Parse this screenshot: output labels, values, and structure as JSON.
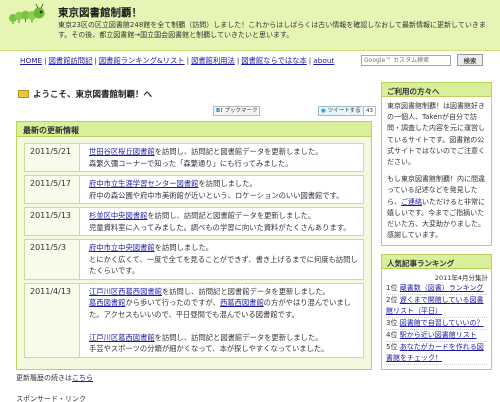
{
  "header": {
    "title": "東京図書館制覇！",
    "description": "東京23区の区立図書館248館を全て制覇（訪問）しました！これからはしばらくは古い情報を確認しなおして最新情報に更新していきます。その後、都立図書館→国立国会図書館と制覇していきたいと思います。"
  },
  "nav": {
    "items": [
      "HOME",
      "図書館訪問記",
      "図書館ランキング&リスト",
      "図書館利用法",
      "図書館ならではな本",
      "about"
    ],
    "search_placeholder": "Google™ カスタム検索",
    "search_button": "検索"
  },
  "main": {
    "welcome": "ようこそ、東京図書館制覇！へ",
    "hatena_label": "ブックマーク",
    "tweet_label": "ツイートする",
    "tweet_count": "43",
    "updates_title": "最新の更新情報",
    "updates": [
      {
        "date": "2011/5/21",
        "link": "世田谷区桜丘図書館",
        "text": "を訪問し、訪問記と図書館データを更新しました。",
        "extra": "森繁久彌コーナーで知った「森繁通り」にも行ってみました。"
      },
      {
        "date": "2011/5/17",
        "link": "府中市立生涯学習センター図書館",
        "text": "を訪問しました。",
        "extra": "府中の森公園や府中市美術館が近いという、ロケーションのいい図書館です。"
      },
      {
        "date": "2011/5/13",
        "link": "杉並区中央図書館",
        "text": "を訪問し、訪問記と図書館データを更新しました。",
        "extra": "児童資料室に入ってみました。調べもの学習に向いた資料がたくさんあります。"
      },
      {
        "date": "2011/5/3",
        "link": "府中市立中央図書館",
        "text": "を訪問しました。",
        "extra": "とにかく広くて、一度で全てを見ることができず、書き上げるまでに何度も訪問したくらいです。"
      },
      {
        "date": "2011/4/13",
        "link": "江戸川区西葛西図書館",
        "text": "を訪問し、訪問記と図書館データを更新しました。",
        "link2": "葛西図書館",
        "text2": "から歩いて行ったのですが、",
        "link3": "西葛西図書館",
        "text3": "の方がやはり混んでいました。アクセスもいいので、平日昼間でも混んでいる図書館です。",
        "link4": "江戸川区葛西図書館",
        "text4": "を訪問し、訪問記と図書館データを更新しました。",
        "extra4": "手芸やスポーツの分類が細かくなって、本が探しやすくなっていました。"
      }
    ],
    "history_prefix": "更新履歴の続きは",
    "history_link": "こちら",
    "sponsor": "スポンサード・リンク"
  },
  "sidebar": {
    "profile_title": "ご利用の方々へ",
    "profile_text1": "東京図書館制覇！は図書館好きの一個人、Takenが自分で訪問・調査した内容を元に運営しているサイトです。図書館の公式サイトではないのでご注意ください。",
    "profile_text2_a": "もし東京図書館制覇！内に間違っている記述などを発見したら、",
    "profile_contact": "ご連絡",
    "profile_text2_b": "いただけると非常に嬉しいです。今までご指摘いただいた方、大変助かりました。感謝しています。",
    "ranking_title": "人気記事ランキング",
    "ranking_month": "2011年4月分集計",
    "ranking": [
      {
        "rank": "1位",
        "title": "蔵書数（図書）ランキング"
      },
      {
        "rank": "2位",
        "title": "遅くまで開館している図書館リスト（平日）"
      },
      {
        "rank": "3位",
        "title": "図書館で自習していいの？"
      },
      {
        "rank": "4位",
        "title": "駅から近い図書館リスト"
      },
      {
        "rank": "5位",
        "title": "あなたがカードを作れる図書館をチェック！"
      }
    ]
  }
}
